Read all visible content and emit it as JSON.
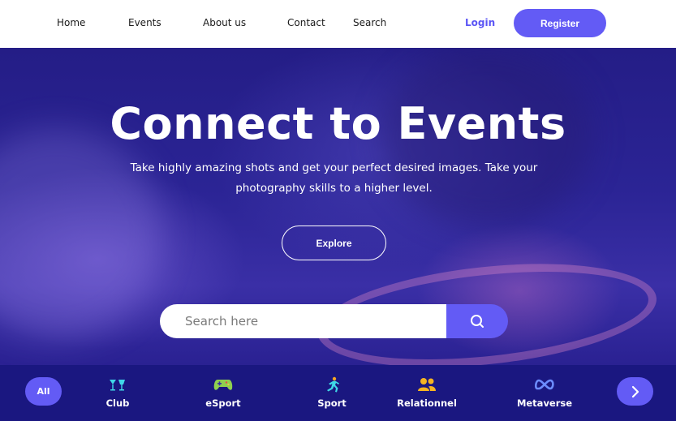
{
  "nav": {
    "items": [
      {
        "label": "Home"
      },
      {
        "label": "Events"
      },
      {
        "label": "About us"
      },
      {
        "label": "Contact"
      },
      {
        "label": "Search"
      }
    ],
    "login_label": "Login",
    "register_label": "Register"
  },
  "hero": {
    "title": "Connect to Events",
    "subtitle": "Take highly amazing shots and get your perfect desired images. Take your photography skills to a higher level.",
    "explore_label": "Explore"
  },
  "search": {
    "placeholder": "Search here",
    "value": "",
    "button_icon": "search-icon"
  },
  "categories": {
    "all_label": "All",
    "items": [
      {
        "label": "Club",
        "icon": "cocktail-icon"
      },
      {
        "label": "eSport",
        "icon": "gamepad-icon"
      },
      {
        "label": "Sport",
        "icon": "runner-icon"
      },
      {
        "label": "Relationnel",
        "icon": "people-icon"
      },
      {
        "label": "Metaverse",
        "icon": "meta-icon"
      }
    ],
    "next_icon": "chevron-right-icon"
  },
  "colors": {
    "accent": "#635bf5",
    "nav_background": "#ffffff",
    "category_bar": "#1a1780"
  }
}
